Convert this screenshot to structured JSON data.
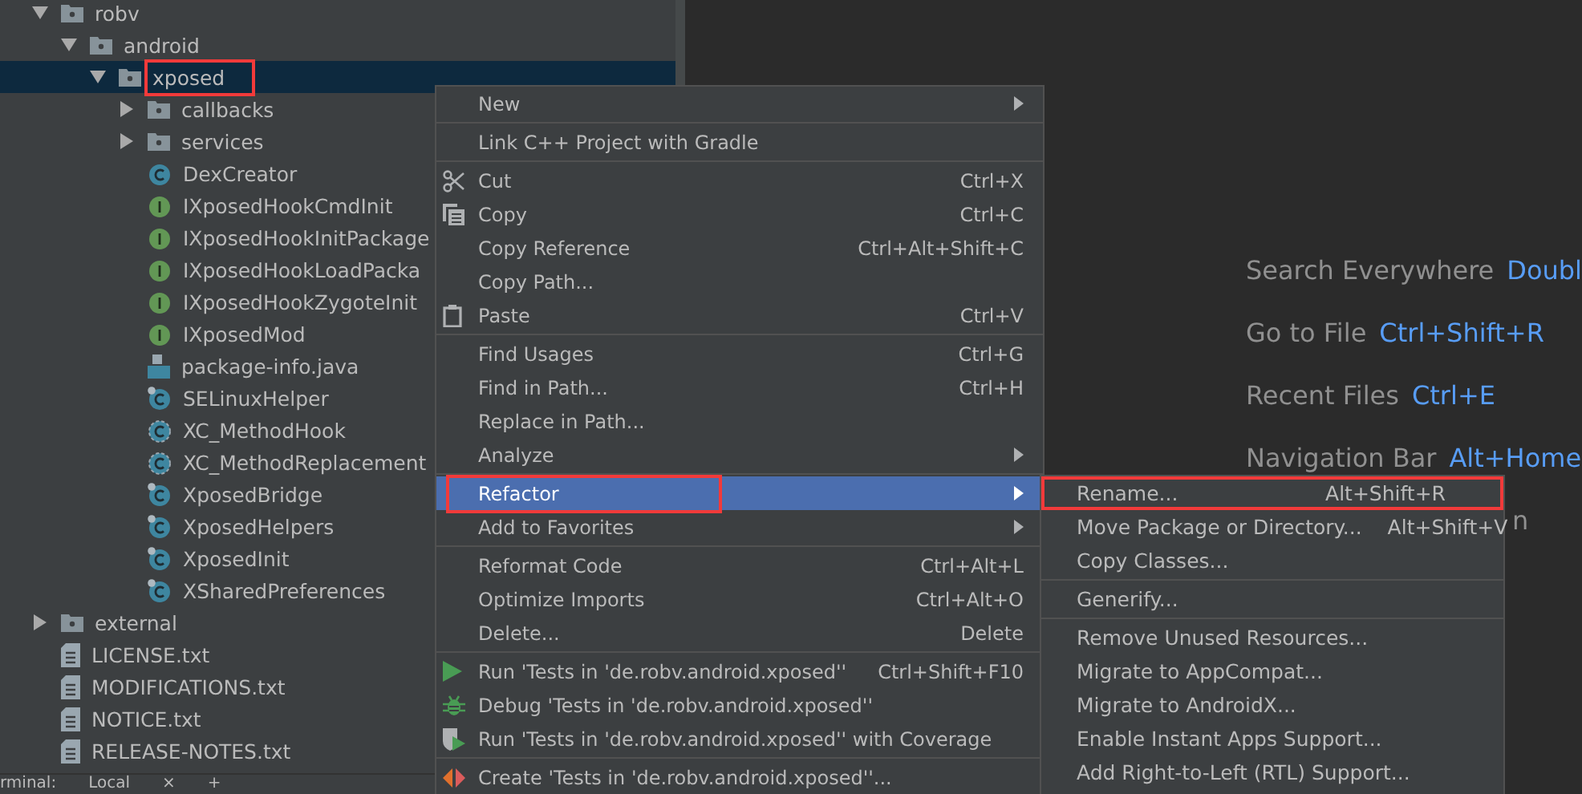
{
  "project_tree": [
    {
      "label": "robv",
      "kind": "package",
      "expanded": true,
      "selected": false,
      "outlined": false,
      "children": [
        {
          "label": "android",
          "kind": "package",
          "expanded": true,
          "selected": false,
          "outlined": false,
          "children": [
            {
              "label": "xposed",
              "kind": "package",
              "expanded": true,
              "selected": true,
              "outlined": true,
              "children": [
                {
                  "label": "callbacks",
                  "kind": "package",
                  "expanded": false,
                  "selected": false,
                  "outlined": false
                },
                {
                  "label": "services",
                  "kind": "package",
                  "expanded": false,
                  "selected": false,
                  "outlined": false
                },
                {
                  "label": "DexCreator",
                  "kind": "class",
                  "selected": false,
                  "outlined": false
                },
                {
                  "label": "IXposedHookCmdInit",
                  "kind": "interface",
                  "selected": false,
                  "outlined": false
                },
                {
                  "label": "IXposedHookInitPackage",
                  "kind": "interface",
                  "selected": false,
                  "outlined": false
                },
                {
                  "label": "IXposedHookLoadPacka",
                  "kind": "interface",
                  "selected": false,
                  "outlined": false
                },
                {
                  "label": "IXposedHookZygoteInit",
                  "kind": "interface",
                  "selected": false,
                  "outlined": false
                },
                {
                  "label": "IXposedMod",
                  "kind": "interface",
                  "selected": false,
                  "outlined": false
                },
                {
                  "label": "package-info.java",
                  "kind": "java-file",
                  "selected": false,
                  "outlined": false
                },
                {
                  "label": "SELinuxHelper",
                  "kind": "final-class",
                  "selected": false,
                  "outlined": false
                },
                {
                  "label": "XC_MethodHook",
                  "kind": "abstract-class",
                  "selected": false,
                  "outlined": false
                },
                {
                  "label": "XC_MethodReplacement",
                  "kind": "abstract-class",
                  "selected": false,
                  "outlined": false
                },
                {
                  "label": "XposedBridge",
                  "kind": "final-class",
                  "selected": false,
                  "outlined": false
                },
                {
                  "label": "XposedHelpers",
                  "kind": "final-class",
                  "selected": false,
                  "outlined": false
                },
                {
                  "label": "XposedInit",
                  "kind": "final-class",
                  "selected": false,
                  "outlined": false
                },
                {
                  "label": "XSharedPreferences",
                  "kind": "final-class",
                  "selected": false,
                  "outlined": false
                }
              ]
            }
          ]
        }
      ]
    },
    {
      "label": "external",
      "kind": "package",
      "expanded": false,
      "selected": false,
      "outlined": false
    },
    {
      "label": "LICENSE.txt",
      "kind": "text-file",
      "selected": false,
      "outlined": false
    },
    {
      "label": "MODIFICATIONS.txt",
      "kind": "text-file",
      "selected": false,
      "outlined": false
    },
    {
      "label": "NOTICE.txt",
      "kind": "text-file",
      "selected": false,
      "outlined": false
    },
    {
      "label": "RELEASE-NOTES.txt",
      "kind": "text-file",
      "selected": false,
      "outlined": false
    }
  ],
  "bottom_tabs": [
    "rminal:",
    "Local",
    "×",
    "+"
  ],
  "editor_hints": [
    {
      "label": "Search Everywhere",
      "shortcut": "Doubl"
    },
    {
      "label": "Go to File",
      "shortcut": "Ctrl+Shift+R"
    },
    {
      "label": "Recent Files",
      "shortcut": "Ctrl+E"
    },
    {
      "label": "Navigation Bar",
      "shortcut": "Alt+Home"
    },
    {
      "label": "n"
    }
  ],
  "context_menu": [
    {
      "kind": "item",
      "label": "New",
      "submenu": true,
      "selected": false,
      "outlined": false
    },
    {
      "kind": "separator"
    },
    {
      "kind": "item",
      "label": "Link C++ Project with Gradle",
      "submenu": false,
      "selected": false,
      "outlined": false
    },
    {
      "kind": "separator"
    },
    {
      "kind": "item",
      "label": "Cut",
      "shortcut": "Ctrl+X",
      "submenu": false,
      "selected": false,
      "outlined": false
    },
    {
      "kind": "item",
      "label": "Copy",
      "shortcut": "Ctrl+C",
      "submenu": false,
      "selected": false,
      "outlined": false
    },
    {
      "kind": "item",
      "label": "Copy Reference",
      "shortcut": "Ctrl+Alt+Shift+C",
      "submenu": false,
      "selected": false,
      "outlined": false
    },
    {
      "kind": "item",
      "label": "Copy Path...",
      "submenu": false,
      "selected": false,
      "outlined": false
    },
    {
      "kind": "item",
      "label": "Paste",
      "shortcut": "Ctrl+V",
      "submenu": false,
      "selected": false,
      "outlined": false
    },
    {
      "kind": "separator"
    },
    {
      "kind": "item",
      "label": "Find Usages",
      "shortcut": "Ctrl+G",
      "submenu": false,
      "selected": false,
      "outlined": false
    },
    {
      "kind": "item",
      "label": "Find in Path...",
      "shortcut": "Ctrl+H",
      "submenu": false,
      "selected": false,
      "outlined": false
    },
    {
      "kind": "item",
      "label": "Replace in Path...",
      "submenu": false,
      "selected": false,
      "outlined": false
    },
    {
      "kind": "item",
      "label": "Analyze",
      "submenu": true,
      "selected": false,
      "outlined": false
    },
    {
      "kind": "separator"
    },
    {
      "kind": "item",
      "label": "Refactor",
      "submenu": true,
      "selected": true,
      "outlined": true
    },
    {
      "kind": "item",
      "label": "Add to Favorites",
      "submenu": true,
      "selected": false,
      "outlined": false
    },
    {
      "kind": "separator"
    },
    {
      "kind": "item",
      "label": "Reformat Code",
      "shortcut": "Ctrl+Alt+L",
      "submenu": false,
      "selected": false,
      "outlined": false
    },
    {
      "kind": "item",
      "label": "Optimize Imports",
      "shortcut": "Ctrl+Alt+O",
      "submenu": false,
      "selected": false,
      "outlined": false
    },
    {
      "kind": "item",
      "label": "Delete...",
      "shortcut": "Delete",
      "submenu": false,
      "selected": false,
      "outlined": false
    },
    {
      "kind": "separator"
    },
    {
      "kind": "item",
      "label": "Run 'Tests in 'de.robv.android.xposed''",
      "shortcut": "Ctrl+Shift+F10",
      "submenu": false,
      "selected": false,
      "outlined": false
    },
    {
      "kind": "item",
      "label": "Debug 'Tests in 'de.robv.android.xposed''",
      "submenu": false,
      "selected": false,
      "outlined": false
    },
    {
      "kind": "item",
      "label": "Run 'Tests in 'de.robv.android.xposed'' with Coverage",
      "submenu": false,
      "selected": false,
      "outlined": false
    },
    {
      "kind": "separator"
    },
    {
      "kind": "item",
      "label": "Create 'Tests in 'de.robv.android.xposed''...",
      "submenu": false,
      "selected": false,
      "outlined": false
    }
  ],
  "refactor_submenu": [
    {
      "kind": "item",
      "label": "Rename...",
      "shortcut": "Alt+Shift+R",
      "selected": false,
      "outlined": true
    },
    {
      "kind": "item",
      "label": "Move Package or Directory...",
      "shortcut": "Alt+Shift+V",
      "selected": false,
      "outlined": false
    },
    {
      "kind": "item",
      "label": "Copy Classes...",
      "selected": false,
      "outlined": false
    },
    {
      "kind": "separator"
    },
    {
      "kind": "item",
      "label": "Generify...",
      "selected": false,
      "outlined": false
    },
    {
      "kind": "separator"
    },
    {
      "kind": "item",
      "label": "Remove Unused Resources...",
      "selected": false,
      "outlined": false
    },
    {
      "kind": "item",
      "label": "Migrate to AppCompat...",
      "selected": false,
      "outlined": false
    },
    {
      "kind": "item",
      "label": "Migrate to AndroidX...",
      "selected": false,
      "outlined": false
    },
    {
      "kind": "item",
      "label": "Enable Instant Apps Support...",
      "selected": false,
      "outlined": false
    },
    {
      "kind": "item",
      "label": "Add Right-to-Left (RTL) Support...",
      "selected": false,
      "outlined": false
    }
  ]
}
